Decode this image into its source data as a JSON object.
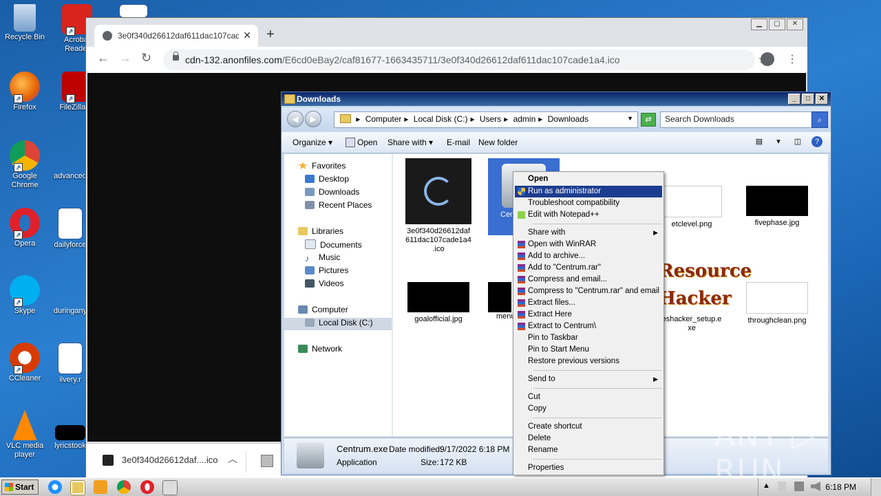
{
  "desktop": {
    "icons": [
      {
        "label": "Recycle Bin",
        "icon": "recycle-bin-icon",
        "color": "#8fb3d9"
      },
      {
        "label": "Acrobat Reader",
        "icon": "acrobat-icon",
        "color": "#d8241c"
      },
      {
        "label": "Firefox",
        "icon": "firefox-icon",
        "color": "#e66000"
      },
      {
        "label": "FileZilla Cl",
        "icon": "filezilla-icon",
        "color": "#bf0000"
      },
      {
        "label": "Google Chrome",
        "icon": "chrome-icon",
        "color": "#4285f4"
      },
      {
        "label": "advanced",
        "icon": "blank-file-icon",
        "color": "#1a5ea8"
      },
      {
        "label": "Opera",
        "icon": "opera-icon",
        "color": "#e0202a"
      },
      {
        "label": "dailyforce",
        "icon": "word-doc-icon",
        "color": "#2b579a"
      },
      {
        "label": "Skype",
        "icon": "skype-icon",
        "color": "#00aff0"
      },
      {
        "label": "duringany",
        "icon": "blank-file-icon",
        "color": "#1a5ea8"
      },
      {
        "label": "CCleaner",
        "icon": "ccleaner-icon",
        "color": "#d83b01"
      },
      {
        "label": "ilvery.r",
        "icon": "word-doc-icon",
        "color": "#2b579a"
      },
      {
        "label": "VLC media player",
        "icon": "vlc-icon",
        "color": "#ff8800"
      },
      {
        "label": "lyricstook",
        "icon": "black-image-icon",
        "color": "#000000"
      }
    ]
  },
  "chrome": {
    "tab_title": "3e0f340d26612daf611dac107cade1a4.ico",
    "tab_close": "✕",
    "new_tab": "+",
    "url_host": "cdn-132.anonfiles.com",
    "url_path": "/E6cd0eBay2/caf81677-1663435711/3e0f340d26612daf611dac107cade1a4.ico",
    "download_name": "3e0f340d26612daf....ico"
  },
  "explorer": {
    "title": "Downloads",
    "breadcrumbs": [
      "Computer",
      "Local Disk (C:)",
      "Users",
      "admin",
      "Downloads"
    ],
    "search_placeholder": "Search Downloads",
    "commands": [
      "Organize ▾",
      "Open",
      "Share with ▾",
      "E-mail",
      "New folder"
    ],
    "nav": {
      "favorites": "Favorites",
      "desktop": "Desktop",
      "downloads": "Downloads",
      "recent": "Recent Places",
      "libraries": "Libraries",
      "documents": "Documents",
      "music": "Music",
      "pictures": "Pictures",
      "videos": "Videos",
      "computer": "Computer",
      "localdisk": "Local Disk (C:)",
      "network": "Network"
    },
    "files": [
      {
        "name": "3e0f340d26612daf611dac107cade1a4.ico",
        "lines": [
          "3e0f340d26612daf",
          "611dac107cade1a4",
          ".ico"
        ]
      },
      {
        "name": "Centrum.exe",
        "lines": [
          "Cen"
        ]
      },
      {
        "name": "etclevel.png",
        "lines": [
          "etclevel.png"
        ]
      },
      {
        "name": "fivephase.jpg",
        "lines": [
          "fivephase.jpg"
        ]
      },
      {
        "name": "goalofficial.jpg",
        "lines": [
          "goalofficial.jpg"
        ]
      },
      {
        "name": "menu",
        "lines": [
          "menu"
        ]
      },
      {
        "name": "reshacker_setup.exe",
        "lines": [
          "eshacker_setup.e",
          "xe"
        ]
      },
      {
        "name": "throughclean.png",
        "lines": [
          "throughclean.png"
        ]
      }
    ],
    "resource_hacker_logo": "Resource Hacker",
    "details": {
      "name": "Centrum.exe",
      "date_label": "Date modified:",
      "date_value": "9/17/2022 6:18 PM",
      "type": "Application",
      "size_label": "Size:",
      "size_value": "172 KB"
    }
  },
  "context_menu": {
    "items": [
      "Open",
      "Run as administrator",
      "Troubleshoot compatibility",
      "Edit with Notepad++",
      "Share with",
      "Open with WinRAR",
      "Add to archive...",
      "Add to \"Centrum.rar\"",
      "Compress and email...",
      "Compress to \"Centrum.rar\" and email",
      "Extract files...",
      "Extract Here",
      "Extract to Centrum\\",
      "Pin to Taskbar",
      "Pin to Start Menu",
      "Restore previous versions",
      "Send to",
      "Cut",
      "Copy",
      "Create shortcut",
      "Delete",
      "Rename",
      "Properties"
    ],
    "highlighted": "Run as administrator"
  },
  "taskbar": {
    "start": "Start",
    "clock": "6:18 PM"
  },
  "watermark": "ANY ▷ RUN"
}
